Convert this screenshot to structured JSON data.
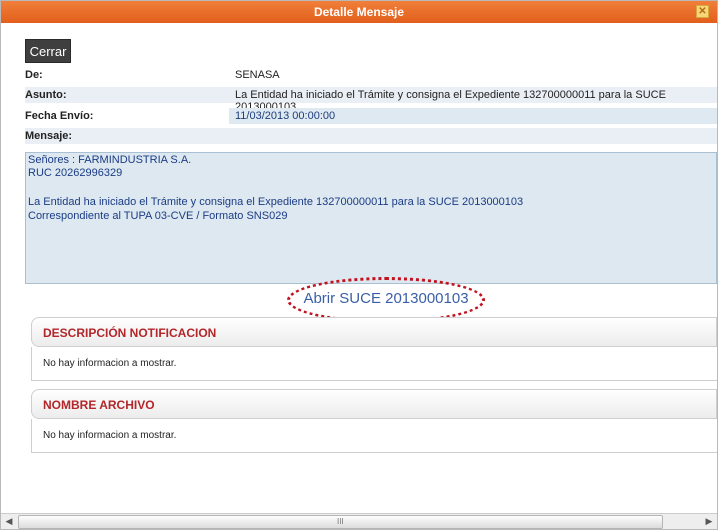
{
  "window": {
    "title": "Detalle Mensaje",
    "close_glyph": "✕"
  },
  "toolbar": {
    "close_label": "Cerrar"
  },
  "fields": {
    "de_label": "De:",
    "de_value": "SENASA",
    "asunto_label": "Asunto:",
    "asunto_value": "La Entidad ha iniciado el Trámite y consigna el Expediente 132700000011 para la SUCE 2013000103",
    "fecha_label": "Fecha Envío:",
    "fecha_value": "11/03/2013 00:00:00",
    "mensaje_label": "Mensaje:"
  },
  "message": {
    "lines": [
      "Señores : FARMINDUSTRIA S.A.",
      "RUC 20262996329",
      "",
      "La Entidad ha iniciado el Trámite y consigna el Expediente 132700000011 para la SUCE 2013000103",
      "Correspondiente al TUPA 03-CVE / Formato SNS029"
    ]
  },
  "link": {
    "label": "Abrir SUCE 2013000103"
  },
  "panels": [
    {
      "title": "DESCRIPCIÓN NOTIFICACION",
      "empty_text": "No hay informacion a mostrar."
    },
    {
      "title": "NOMBRE ARCHIVO",
      "empty_text": "No hay informacion a mostrar."
    }
  ],
  "scrollbar": {
    "left_arrow": "◀",
    "right_arrow": "▶",
    "grip": "III"
  },
  "colors": {
    "titlebar": "#e8692a",
    "panel_title": "#b3262a",
    "link": "#3a5fa6",
    "annotation_oval": "#c1121f"
  }
}
